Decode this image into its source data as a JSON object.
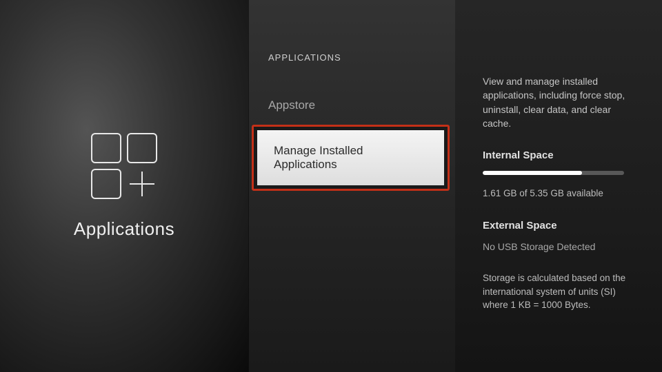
{
  "left": {
    "title": "Applications"
  },
  "mid": {
    "heading": "APPLICATIONS",
    "items": [
      {
        "label": "Appstore"
      },
      {
        "label": "Manage Installed Applications"
      }
    ]
  },
  "right": {
    "description": "View and manage installed applications, including force stop, uninstall, clear data, and clear cache.",
    "internal": {
      "title": "Internal Space",
      "used_gb": 1.61,
      "total_gb": 5.35,
      "progress_percent": 70,
      "available_text": "1.61 GB of 5.35 GB available"
    },
    "external": {
      "title": "External Space",
      "status": "No USB Storage Detected"
    },
    "footnote": "Storage is calculated based on the international system of units (SI) where 1 KB = 1000 Bytes."
  },
  "colors": {
    "highlight_border": "#c33018"
  }
}
